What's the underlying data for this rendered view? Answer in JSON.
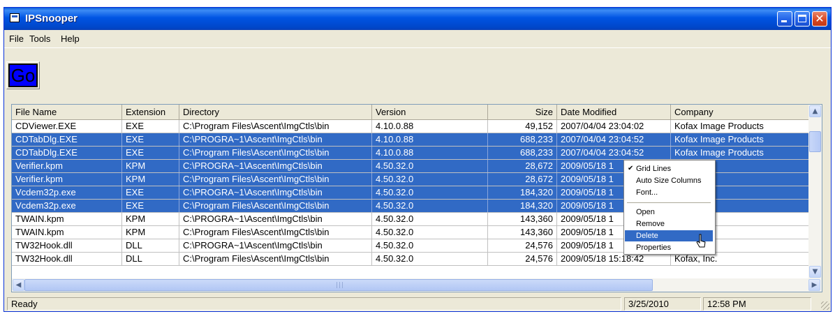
{
  "window": {
    "title": "IPSnooper",
    "caption_buttons": [
      "minimize-icon",
      "maximize-icon",
      "close-icon"
    ]
  },
  "menubar": {
    "items": [
      "File",
      "Tools",
      "Help"
    ]
  },
  "toolbar": {
    "go_label": "Go"
  },
  "columns": [
    "File Name",
    "Extension",
    "Directory",
    "Version",
    "Size",
    "Date Modified",
    "Company"
  ],
  "rows": [
    {
      "name": "CDViewer.EXE",
      "ext": "EXE",
      "dir": "C:\\Program Files\\Ascent\\ImgCtls\\bin",
      "ver": "4.10.0.88",
      "size": "49,152",
      "date": "2007/04/04 23:04:02",
      "company": "Kofax Image Products",
      "selected": false
    },
    {
      "name": "CDTabDlg.EXE",
      "ext": "EXE",
      "dir": "C:\\PROGRA~1\\Ascent\\ImgCtls\\bin",
      "ver": "4.10.0.88",
      "size": "688,233",
      "date": "2007/04/04 23:04:52",
      "company": "Kofax Image Products",
      "selected": true
    },
    {
      "name": "CDTabDlg.EXE",
      "ext": "EXE",
      "dir": "C:\\Program Files\\Ascent\\ImgCtls\\bin",
      "ver": "4.10.0.88",
      "size": "688,233",
      "date": "2007/04/04 23:04:52",
      "company": "Kofax Image Products",
      "selected": true
    },
    {
      "name": "Verifier.kpm",
      "ext": "KPM",
      "dir": "C:\\PROGRA~1\\Ascent\\ImgCtls\\bin",
      "ver": "4.50.32.0",
      "size": "28,672",
      "date": "2009/05/18 1",
      "company": "c.",
      "selected": true
    },
    {
      "name": "Verifier.kpm",
      "ext": "KPM",
      "dir": "C:\\Program Files\\Ascent\\ImgCtls\\bin",
      "ver": "4.50.32.0",
      "size": "28,672",
      "date": "2009/05/18 1",
      "company": "c.",
      "selected": true
    },
    {
      "name": "Vcdem32p.exe",
      "ext": "EXE",
      "dir": "C:\\PROGRA~1\\Ascent\\ImgCtls\\bin",
      "ver": "4.50.32.0",
      "size": "184,320",
      "date": "2009/05/18 1",
      "company": "c.",
      "selected": true
    },
    {
      "name": "Vcdem32p.exe",
      "ext": "EXE",
      "dir": "C:\\Program Files\\Ascent\\ImgCtls\\bin",
      "ver": "4.50.32.0",
      "size": "184,320",
      "date": "2009/05/18 1",
      "company": "c.",
      "selected": true
    },
    {
      "name": "TWAIN.kpm",
      "ext": "KPM",
      "dir": "C:\\PROGRA~1\\Ascent\\ImgCtls\\bin",
      "ver": "4.50.32.0",
      "size": "143,360",
      "date": "2009/05/18 1",
      "company": "c.",
      "selected": false
    },
    {
      "name": "TWAIN.kpm",
      "ext": "KPM",
      "dir": "C:\\Program Files\\Ascent\\ImgCtls\\bin",
      "ver": "4.50.32.0",
      "size": "143,360",
      "date": "2009/05/18 1",
      "company": "c.",
      "selected": false
    },
    {
      "name": "TW32Hook.dll",
      "ext": "DLL",
      "dir": "C:\\PROGRA~1\\Ascent\\ImgCtls\\bin",
      "ver": "4.50.32.0",
      "size": "24,576",
      "date": "2009/05/18 1",
      "company": "c.",
      "selected": false
    },
    {
      "name": "TW32Hook.dll",
      "ext": "DLL",
      "dir": "C:\\Program Files\\Ascent\\ImgCtls\\bin",
      "ver": "4.50.32.0",
      "size": "24,576",
      "date": "2009/05/18 15:18:42",
      "company": "Kofax, Inc.",
      "selected": false
    }
  ],
  "context_menu": {
    "items": [
      {
        "label": "Grid Lines",
        "checked": true,
        "highlighted": false
      },
      {
        "label": "Auto Size Columns",
        "checked": false,
        "highlighted": false
      },
      {
        "label": "Font...",
        "checked": false,
        "highlighted": false
      },
      {
        "separator": true
      },
      {
        "label": "Open",
        "checked": false,
        "highlighted": false
      },
      {
        "label": "Remove",
        "checked": false,
        "highlighted": false
      },
      {
        "label": "Delete",
        "checked": false,
        "highlighted": true
      },
      {
        "label": "Properties",
        "checked": false,
        "highlighted": false
      }
    ]
  },
  "statusbar": {
    "status": "Ready",
    "date": "3/25/2010",
    "time": "12:58 PM"
  },
  "colors": {
    "selection": "#316ac5",
    "title_bar": "#0054e3",
    "go_button": "#0000ff",
    "window_face": "#ece9d8"
  }
}
